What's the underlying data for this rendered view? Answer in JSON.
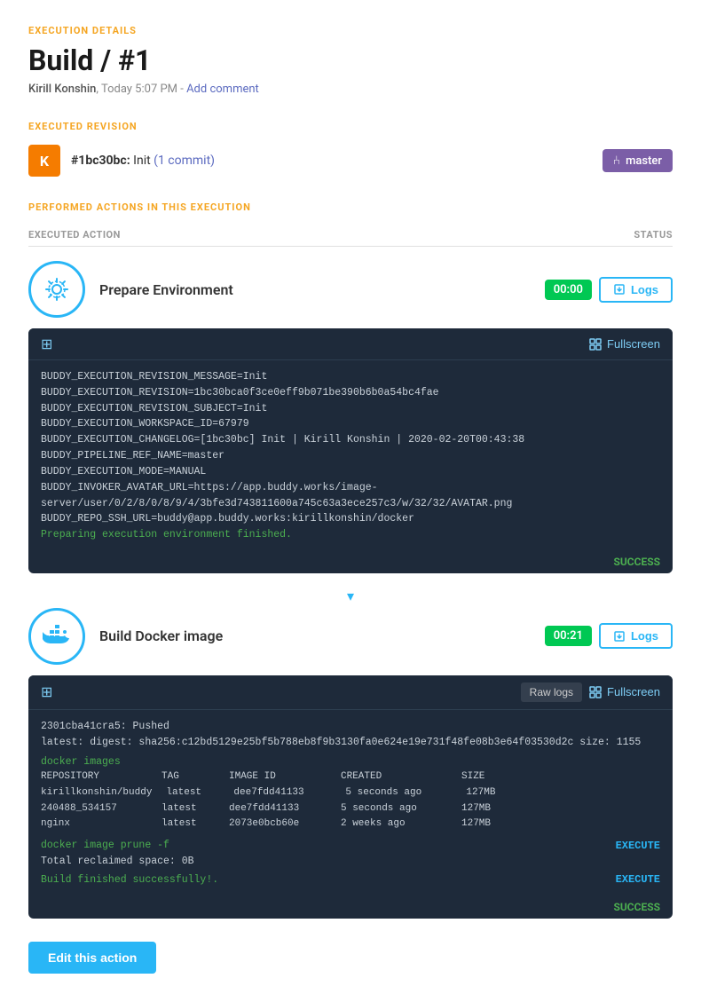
{
  "page": {
    "section_label": "EXECUTION DETAILS",
    "title": "Build / #1",
    "meta": {
      "author": "Kirill Konshin",
      "time": "Today 5:07 PM",
      "separator": " - ",
      "add_comment": "Add comment"
    }
  },
  "revision": {
    "section_label": "EXECUTED REVISION",
    "avatar_letter": "K",
    "hash": "#1bc30bc:",
    "message": "Init",
    "commits": "(1 commit)",
    "branch": "master"
  },
  "actions": {
    "section_label": "PERFORMED ACTIONS IN THIS EXECUTION",
    "col_action": "EXECUTED ACTION",
    "col_status": "STATUS",
    "items": [
      {
        "name": "Prepare Environment",
        "time": "00:00",
        "logs_label": "Logs"
      },
      {
        "name": "Build Docker image",
        "time": "00:21",
        "logs_label": "Logs"
      }
    ]
  },
  "terminal1": {
    "fullscreen_label": "Fullscreen",
    "status": "SUCCESS",
    "lines": [
      "BUDDY_EXECUTION_REVISION_MESSAGE=Init",
      "BUDDY_EXECUTION_REVISION=1bc30bca0f3ce0eff9b071be390b6b0a54bc4fae",
      "BUDDY_EXECUTION_REVISION_SUBJECT=Init",
      "BUDDY_EXECUTION_WORKSPACE_ID=67979",
      "BUDDY_EXECUTION_CHANGELOG=[1bc30bc] Init | Kirill Konshin | 2020-02-20T00:43:38",
      "BUDDY_PIPELINE_REF_NAME=master",
      "BUDDY_EXECUTION_MODE=MANUAL",
      "BUDDY_INVOKER_AVATAR_URL=https://app.buddy.works/image-server/user/0/2/8/0/8/9/4/3bfe3d743811600a745c63a3ece257c3/w/32/32/AVATAR.png",
      "BUDDY_REPO_SSH_URL=buddy@app.buddy.works:kirillkonshin/docker"
    ],
    "success_line": "Preparing execution environment finished."
  },
  "terminal2": {
    "raw_logs_label": "Raw logs",
    "fullscreen_label": "Fullscreen",
    "lines": [
      "2301cba41cra5: Pushed",
      "latest: digest: sha256:c12bd5129e25bf5b788eb8f9b3130fa0e624e19e731f48fe08b3e64f03530d2c size: 1155"
    ],
    "docker_images_cmd": "docker images",
    "docker_header": {
      "repo": "REPOSITORY",
      "tag": "TAG",
      "id": "IMAGE ID",
      "created": "CREATED",
      "size": "SIZE"
    },
    "docker_rows": [
      {
        "repo": "kirillkonshin/buddy",
        "tag": "latest",
        "id": "dee7fdd41133",
        "created": "5 seconds ago",
        "size": "127MB"
      },
      {
        "repo": "240488_534157",
        "tag": "latest",
        "id": "dee7fdd41133",
        "created": "5 seconds ago",
        "size": "127MB"
      },
      {
        "repo": "nginx",
        "tag": "latest",
        "id": "2073e0bcb60e",
        "created": "2 weeks ago",
        "size": "127MB"
      }
    ],
    "prune_cmd": "docker image prune -f",
    "reclaim_line": "Total reclaimed space: 0B",
    "finish_line": "Build finished successfully!.",
    "execute1": "EXECUTE",
    "execute2": "EXECUTE",
    "status": "SUCCESS"
  },
  "edit_button": {
    "label": "Edit this action"
  }
}
